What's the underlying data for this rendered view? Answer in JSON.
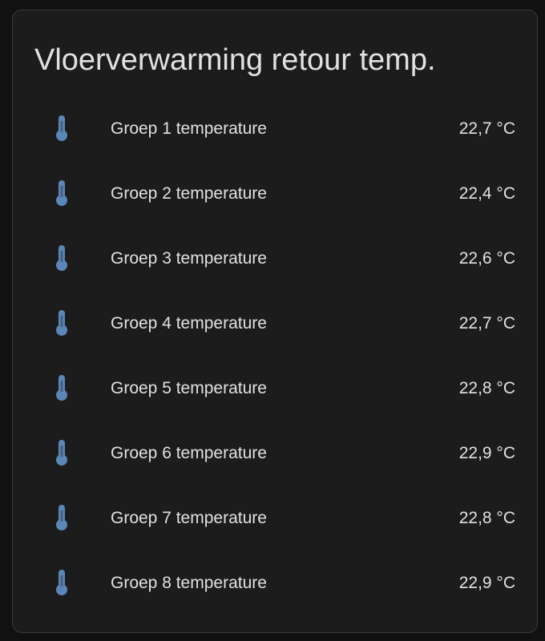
{
  "card": {
    "title": "Vloerverwarming retour temp.",
    "icon_color": "#5b86b8",
    "entities": [
      {
        "name": "Groep 1 temperature",
        "state": "22,7 °C",
        "icon": "thermometer-icon"
      },
      {
        "name": "Groep 2 temperature",
        "state": "22,4 °C",
        "icon": "thermometer-icon"
      },
      {
        "name": "Groep 3 temperature",
        "state": "22,6 °C",
        "icon": "thermometer-icon"
      },
      {
        "name": "Groep 4 temperature",
        "state": "22,7 °C",
        "icon": "thermometer-icon"
      },
      {
        "name": "Groep 5 temperature",
        "state": "22,8 °C",
        "icon": "thermometer-icon"
      },
      {
        "name": "Groep 6 temperature",
        "state": "22,9 °C",
        "icon": "thermometer-icon"
      },
      {
        "name": "Groep 7 temperature",
        "state": "22,8 °C",
        "icon": "thermometer-icon"
      },
      {
        "name": "Groep 8 temperature",
        "state": "22,9 °C",
        "icon": "thermometer-icon"
      }
    ]
  }
}
